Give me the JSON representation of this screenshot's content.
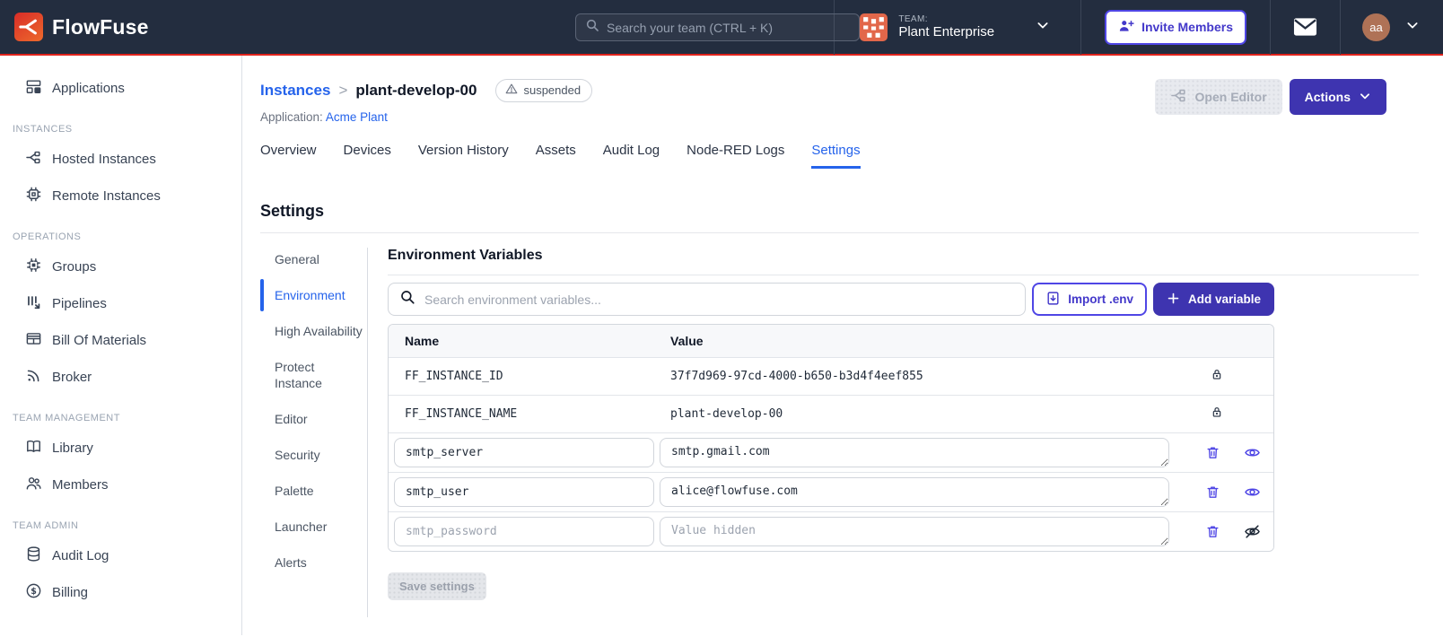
{
  "header": {
    "brand": "FlowFuse",
    "search": {
      "placeholder": "Search your team (CTRL + K)"
    },
    "team": {
      "label": "TEAM:",
      "name": "Plant Enterprise"
    },
    "invite_button": "Invite Members",
    "avatar": "aa"
  },
  "sidebar": {
    "top_item": {
      "label": "Applications"
    },
    "sections": [
      {
        "label": "INSTANCES",
        "items": [
          {
            "label": "Hosted Instances"
          },
          {
            "label": "Remote Instances"
          }
        ]
      },
      {
        "label": "OPERATIONS",
        "items": [
          {
            "label": "Groups"
          },
          {
            "label": "Pipelines"
          },
          {
            "label": "Bill Of Materials"
          },
          {
            "label": "Broker"
          }
        ]
      },
      {
        "label": "TEAM MANAGEMENT",
        "items": [
          {
            "label": "Library"
          },
          {
            "label": "Members"
          }
        ]
      },
      {
        "label": "TEAM ADMIN",
        "items": [
          {
            "label": "Audit Log"
          },
          {
            "label": "Billing"
          }
        ]
      }
    ]
  },
  "page": {
    "breadcrumb": {
      "parent": "Instances",
      "separator": ">",
      "current": "plant-develop-00"
    },
    "status_badge": "suspended",
    "application": {
      "label": "Application:",
      "name": "Acme Plant"
    },
    "toolbar": {
      "open_editor": "Open Editor",
      "actions": "Actions"
    },
    "tabs": [
      {
        "label": "Overview"
      },
      {
        "label": "Devices"
      },
      {
        "label": "Version History"
      },
      {
        "label": "Assets"
      },
      {
        "label": "Audit Log"
      },
      {
        "label": "Node-RED Logs"
      },
      {
        "label": "Settings"
      }
    ]
  },
  "settings": {
    "title": "Settings",
    "nav": [
      {
        "label": "General"
      },
      {
        "label": "Environment"
      },
      {
        "label": "High Availability"
      },
      {
        "label": "Protect Instance"
      },
      {
        "label": "Editor"
      },
      {
        "label": "Security"
      },
      {
        "label": "Palette"
      },
      {
        "label": "Launcher"
      },
      {
        "label": "Alerts"
      }
    ],
    "env": {
      "title": "Environment Variables",
      "search_placeholder": "Search environment variables...",
      "import_button": "Import .env",
      "add_button": "Add variable",
      "columns": {
        "name": "Name",
        "value": "Value"
      },
      "locked_rows": [
        {
          "name": "FF_INSTANCE_ID",
          "value": "37f7d969-97cd-4000-b650-b3d4f4eef855"
        },
        {
          "name": "FF_INSTANCE_NAME",
          "value": "plant-develop-00"
        }
      ],
      "editable_rows": [
        {
          "name": "smtp_server",
          "value": "smtp.gmail.com"
        },
        {
          "name": "smtp_user",
          "value": "alice@flowfuse.com"
        },
        {
          "name": "smtp_password",
          "value_placeholder": "Value hidden"
        }
      ],
      "save_button": "Save settings"
    }
  }
}
